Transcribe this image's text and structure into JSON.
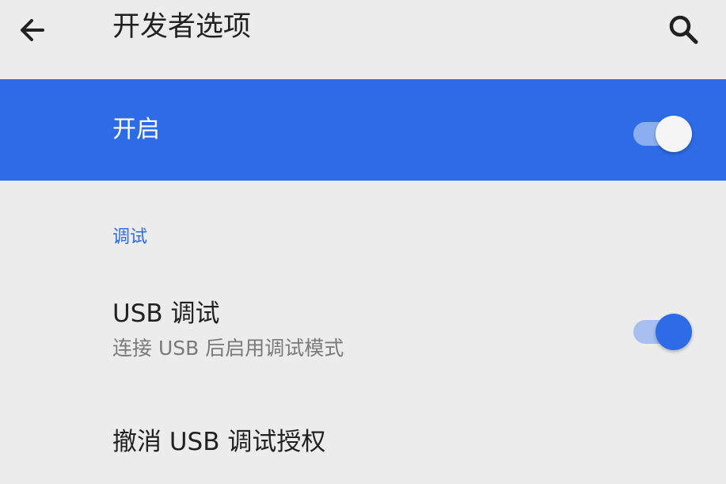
{
  "header": {
    "title": "开发者选项",
    "back_icon": "arrow-left-icon",
    "search_icon": "search-icon"
  },
  "master": {
    "label": "开启",
    "enabled": true
  },
  "sections": [
    {
      "header": "调试",
      "items": [
        {
          "title": "USB 调试",
          "summary": "连接 USB 后启用调试模式",
          "switch_on": true
        },
        {
          "title": "撤消 USB 调试授权"
        }
      ]
    }
  ],
  "colors": {
    "accent": "#2d6ce6",
    "background": "#ececec",
    "title_text": "#212121",
    "summary_text": "#7a7a7a"
  }
}
